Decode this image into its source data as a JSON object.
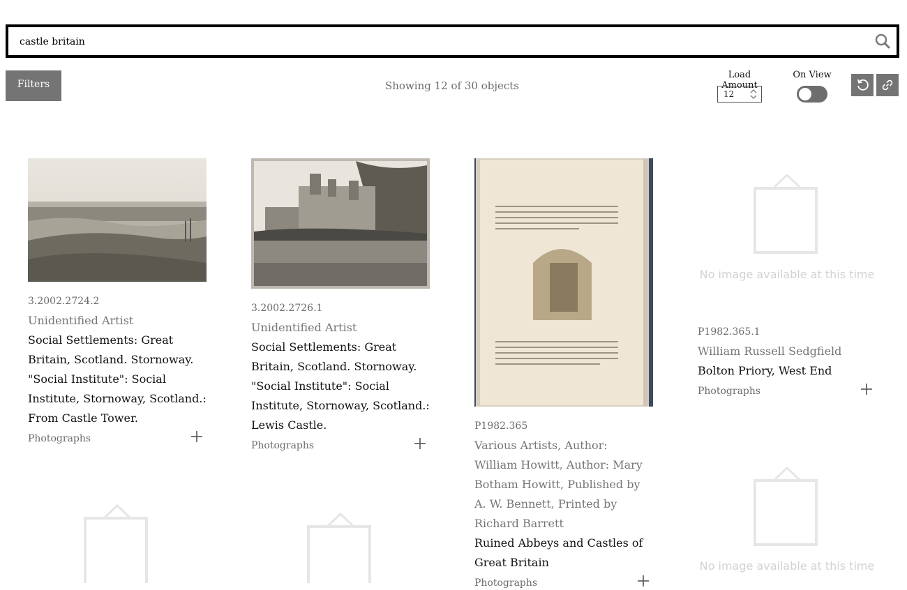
{
  "search": {
    "value": "castle britain"
  },
  "toolbar": {
    "filters_label": "Filters",
    "showing_text": "Showing 12 of 30 objects",
    "load_amount_label": "Load Amount",
    "load_amount_value": "12",
    "on_view_label": "On View"
  },
  "icons": {
    "search": "search-icon",
    "reset": "reset-icon",
    "link": "link-icon",
    "add": "plus-icon",
    "frame": "picture-frame-icon"
  },
  "no_image_text": "No image available at this time",
  "results": [
    {
      "accession": "3.2002.2724.2",
      "artist": "Unidentified Artist",
      "title": "Social Settlements: Great Britain, Scotland. Stornoway. \"Social Institute\": Social Institute, Stornoway, Scotland.: From Castle Tower.",
      "category": "Photographs",
      "has_image": true
    },
    {
      "accession": "3.2002.2726.1",
      "artist": "Unidentified Artist",
      "title": "Social Settlements: Great Britain, Scotland. Stornoway. \"Social Institute\": Social Institute, Stornoway, Scotland.: Lewis Castle.",
      "category": "Photographs",
      "has_image": true
    },
    {
      "accession": "P1982.365",
      "artist": "Various Artists, Author: William Howitt, Author: Mary Botham Howitt, Published by A. W. Bennett, Printed by Richard Barrett",
      "title": "Ruined Abbeys and Castles of Great Britain",
      "category": "Photographs",
      "has_image": true
    },
    {
      "accession": "P1982.365.1",
      "artist": "William Russell Sedgfield",
      "title": "Bolton Priory, West End",
      "category": "Photographs",
      "has_image": false
    }
  ],
  "colors": {
    "button_bg": "#747474",
    "muted_text": "#6b6b6b",
    "placeholder_gray": "#d2d2d2"
  }
}
